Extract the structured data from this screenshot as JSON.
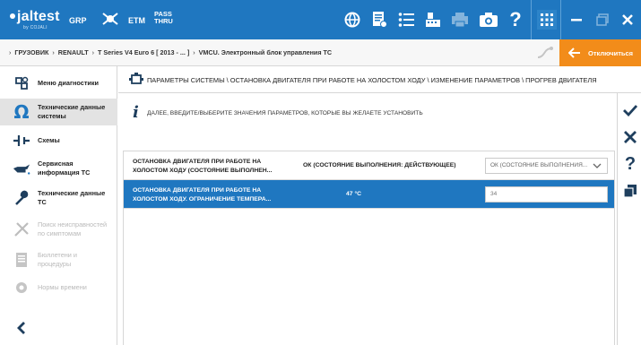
{
  "topbar": {
    "logo": "jaltest",
    "logo_sub": "by COJALI",
    "grp": "GRP",
    "etm": "ETM",
    "pass": "PASS",
    "thru": "THRU"
  },
  "breadcrumb": {
    "items": [
      "ГРУЗОВИК",
      "RENAULT",
      "T Series V4 Euro 6 [ 2013 - ... ]",
      "VMCU. Электронный блок управления ТС"
    ]
  },
  "disconnect_label": "Отключиться",
  "sidebar": {
    "items": [
      {
        "label": "Меню диагностики",
        "icon": "diagnostics-menu-icon"
      },
      {
        "label": "Технические данные системы",
        "icon": "ohm-icon"
      },
      {
        "label": "Схемы",
        "icon": "schematics-icon"
      },
      {
        "label": "Сервисная информация ТС",
        "icon": "oil-can-icon"
      },
      {
        "label": "Технические данные ТС",
        "icon": "wrench-icon"
      },
      {
        "label": "Поиск неисправностей по симптомам",
        "icon": "tools-icon"
      },
      {
        "label": "Бюллетени и процедуры",
        "icon": "document-icon"
      },
      {
        "label": "Нормы времени",
        "icon": "clock-gear-icon"
      }
    ]
  },
  "main": {
    "path": "ПАРАМЕТРЫ СИСТЕМЫ \\ ОСТАНОВКА ДВИГАТЕЛЯ ПРИ РАБОТЕ НА ХОЛОСТОМ ХОДУ \\ ИЗМЕНЕНИЕ ПАРАМЕТРОВ \\ ПРОГРЕВ ДВИГАТЕЛЯ",
    "info": "ДАЛЕЕ, ВВЕДИТЕ/ВЫБЕРИТЕ ЗНАЧЕНИЯ ПАРАМЕТРОВ, КОТОРЫЕ ВЫ ЖЕЛАЕТЕ УСТАНОВИТЬ"
  },
  "params": [
    {
      "name": "ОСТАНОВКА ДВИГАТЕЛЯ ПРИ РАБОТЕ НА ХОЛОСТОМ ХОДУ (СОСТОЯНИЕ ВЫПОЛНЕН...",
      "value": "ОК (СОСТОЯНИЕ ВЫПОЛНЕНИЯ: ДЕЙСТВУЮЩЕЕ)",
      "control": "ОК (СОСТОЯНИЕ ВЫПОЛНЕНИЯ...",
      "control_type": "select"
    },
    {
      "name": "ОСТАНОВКА ДВИГАТЕЛЯ ПРИ РАБОТЕ НА ХОЛОСТОМ ХОДУ. ОГРАНИЧЕНИЕ ТЕМПЕРА...",
      "value": "47 °C",
      "control": "34",
      "control_type": "input"
    }
  ],
  "colors": {
    "topbar": "#1f77c0",
    "accent_orange": "#f28c1a",
    "selected_row": "#1f77c0"
  }
}
